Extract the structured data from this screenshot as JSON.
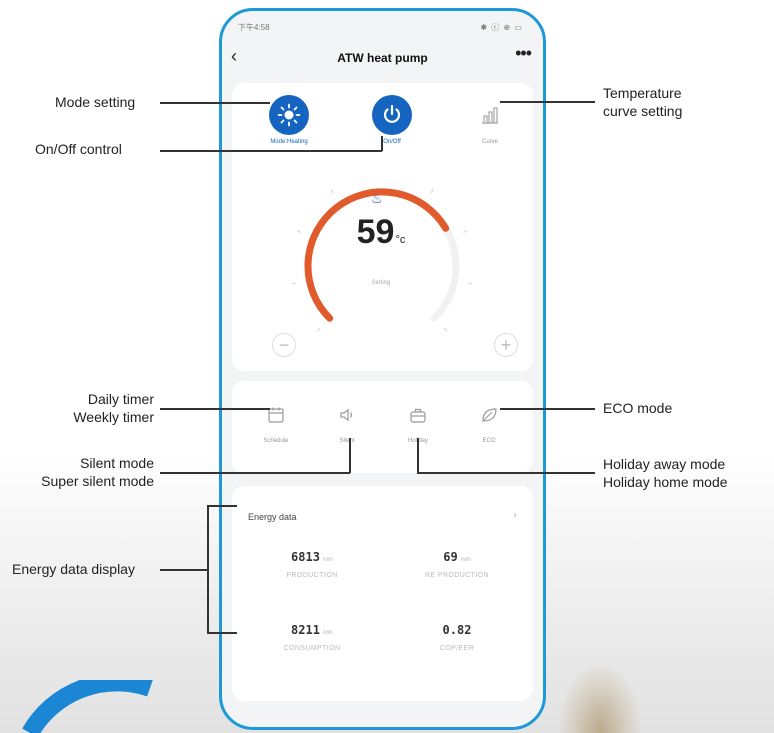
{
  "phone": {
    "status_time": "下午4:58",
    "status_icons": "✱ ⓒ ⊕ ▭",
    "title": "ATW heat pump",
    "back_glyph": "‹",
    "more_glyph": "•••"
  },
  "modes": {
    "mode_label": "Mode:Heating",
    "onoff_label": "On/Off",
    "curve_label": "Curve"
  },
  "dial": {
    "temperature": "59",
    "unit": "°c",
    "caption": "Setting",
    "minus": "−",
    "plus": "+",
    "arc_color": "#e05a2b",
    "value_fraction": 0.72
  },
  "functions": {
    "schedule": "Schedule",
    "silent": "Silent",
    "holiday": "Holiday",
    "eco": "ECO"
  },
  "energy": {
    "title": "Energy data",
    "more": "›",
    "production_value": "6813",
    "production_unit": "kWh",
    "production_label": "PRODUCTION",
    "re_production_value": "69",
    "re_production_unit": "kWh",
    "re_production_label": "RE PRODUCTION",
    "consumption_value": "8211",
    "consumption_unit": "kWh",
    "consumption_label": "CONSUMPTION",
    "cop_value": "0.82",
    "cop_label": "COP/EER"
  },
  "callouts": {
    "mode_setting": "Mode setting",
    "onoff_control": "On/Off control",
    "temp_curve_line1": "Temperature",
    "temp_curve_line2": "curve setting",
    "daily_timer": "Daily timer",
    "weekly_timer": "Weekly timer",
    "silent_mode": "Silent mode",
    "super_silent_mode": "Super silent mode",
    "eco_mode": "ECO mode",
    "holiday_away": "Holiday away mode",
    "holiday_home": "Holiday home mode",
    "energy_display": "Energy data display"
  },
  "colors": {
    "phone_border": "#1d9ad6",
    "accent": "#1565c0",
    "dial": "#e05a2b"
  }
}
